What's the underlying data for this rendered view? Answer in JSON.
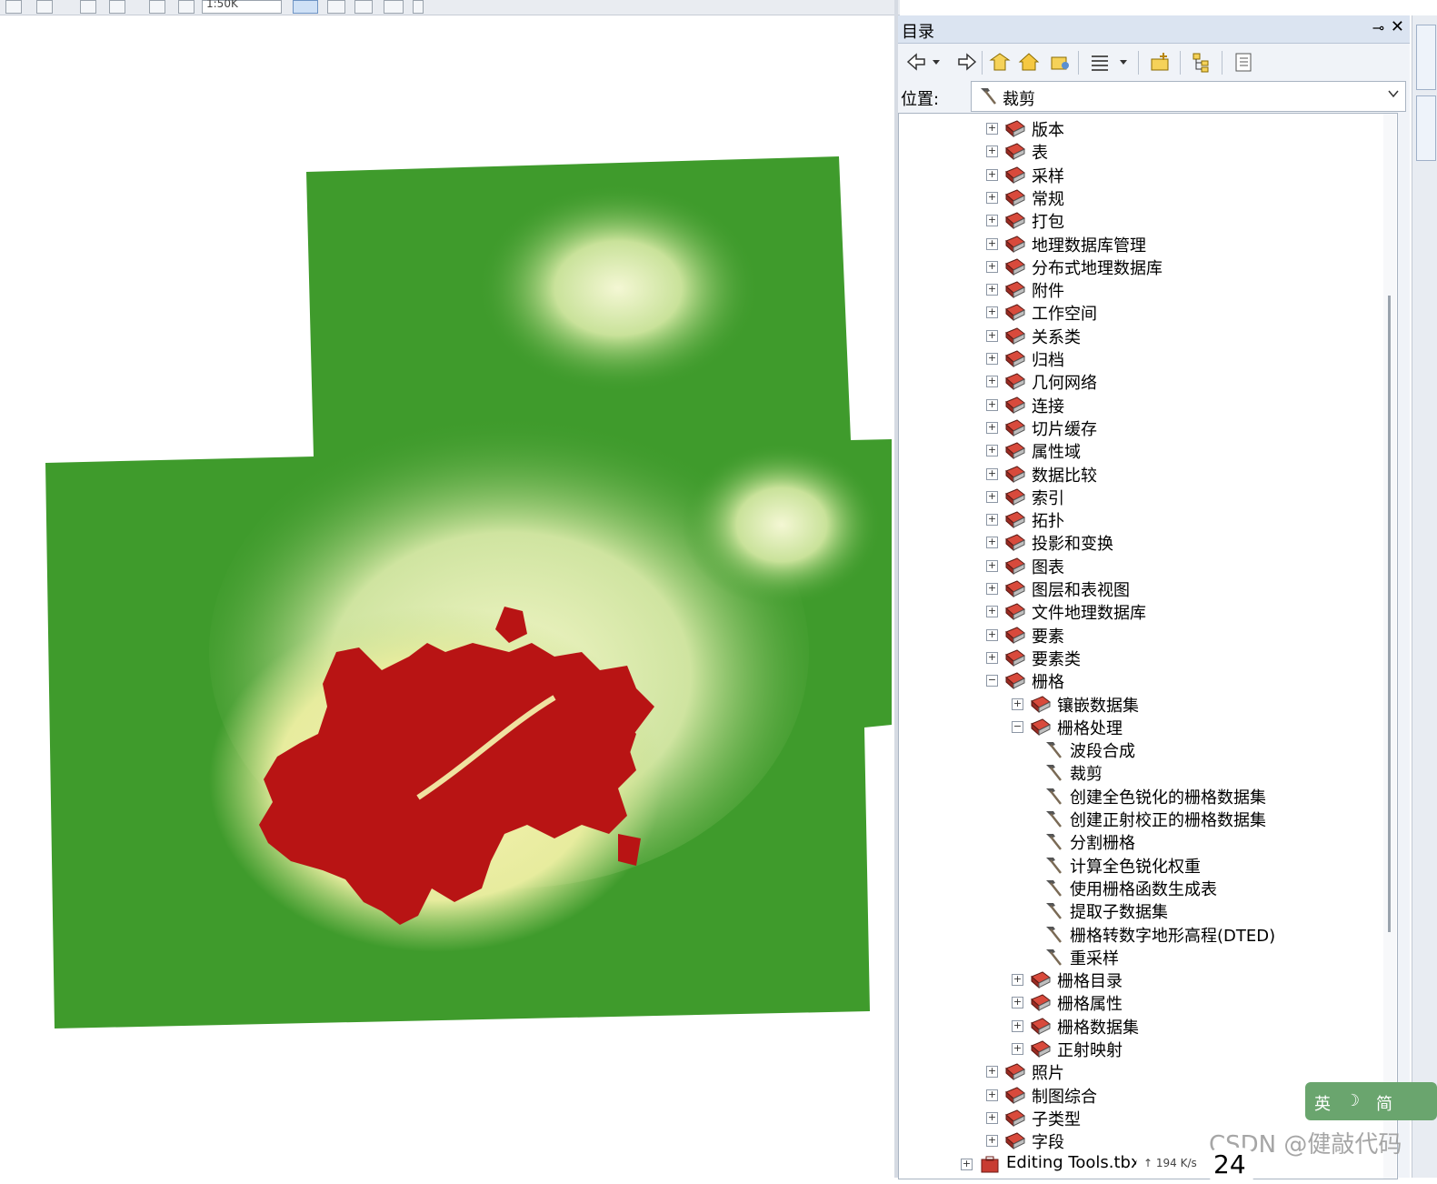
{
  "top_toolbar": {
    "zoom_value": "1:50K"
  },
  "catalog": {
    "title": "目录",
    "pin_glyph": "⊸",
    "close_glyph": "✕",
    "location_label": "位置:",
    "location_value": "裁剪",
    "toolbar_icons": [
      "back-icon",
      "dropdown-icon",
      "forward-icon",
      "up-folder-icon",
      "home-icon",
      "connect-folder-icon",
      "grid-view-icon",
      "dropdown-icon",
      "new-toolbox-icon",
      "tree-view-icon",
      "options-icon"
    ],
    "tree": [
      {
        "label": "版本",
        "level": 0,
        "type": "toolset",
        "state": "collapsed"
      },
      {
        "label": "表",
        "level": 0,
        "type": "toolset",
        "state": "collapsed"
      },
      {
        "label": "采样",
        "level": 0,
        "type": "toolset",
        "state": "collapsed"
      },
      {
        "label": "常规",
        "level": 0,
        "type": "toolset",
        "state": "collapsed"
      },
      {
        "label": "打包",
        "level": 0,
        "type": "toolset",
        "state": "collapsed"
      },
      {
        "label": "地理数据库管理",
        "level": 0,
        "type": "toolset",
        "state": "collapsed"
      },
      {
        "label": "分布式地理数据库",
        "level": 0,
        "type": "toolset",
        "state": "collapsed"
      },
      {
        "label": "附件",
        "level": 0,
        "type": "toolset",
        "state": "collapsed"
      },
      {
        "label": "工作空间",
        "level": 0,
        "type": "toolset",
        "state": "collapsed"
      },
      {
        "label": "关系类",
        "level": 0,
        "type": "toolset",
        "state": "collapsed"
      },
      {
        "label": "归档",
        "level": 0,
        "type": "toolset",
        "state": "collapsed"
      },
      {
        "label": "几何网络",
        "level": 0,
        "type": "toolset",
        "state": "collapsed"
      },
      {
        "label": "连接",
        "level": 0,
        "type": "toolset",
        "state": "collapsed"
      },
      {
        "label": "切片缓存",
        "level": 0,
        "type": "toolset",
        "state": "collapsed"
      },
      {
        "label": "属性域",
        "level": 0,
        "type": "toolset",
        "state": "collapsed"
      },
      {
        "label": "数据比较",
        "level": 0,
        "type": "toolset",
        "state": "collapsed"
      },
      {
        "label": "索引",
        "level": 0,
        "type": "toolset",
        "state": "collapsed"
      },
      {
        "label": "拓扑",
        "level": 0,
        "type": "toolset",
        "state": "collapsed"
      },
      {
        "label": "投影和变换",
        "level": 0,
        "type": "toolset",
        "state": "collapsed"
      },
      {
        "label": "图表",
        "level": 0,
        "type": "toolset",
        "state": "collapsed"
      },
      {
        "label": "图层和表视图",
        "level": 0,
        "type": "toolset",
        "state": "collapsed"
      },
      {
        "label": "文件地理数据库",
        "level": 0,
        "type": "toolset",
        "state": "collapsed"
      },
      {
        "label": "要素",
        "level": 0,
        "type": "toolset",
        "state": "collapsed"
      },
      {
        "label": "要素类",
        "level": 0,
        "type": "toolset",
        "state": "collapsed"
      },
      {
        "label": "栅格",
        "level": 0,
        "type": "toolset",
        "state": "expanded"
      },
      {
        "label": "镶嵌数据集",
        "level": 1,
        "type": "toolset",
        "state": "collapsed"
      },
      {
        "label": "栅格处理",
        "level": 1,
        "type": "toolset",
        "state": "expanded"
      },
      {
        "label": "波段合成",
        "level": 2,
        "type": "tool",
        "state": "none"
      },
      {
        "label": "裁剪",
        "level": 2,
        "type": "tool",
        "state": "none"
      },
      {
        "label": "创建全色锐化的栅格数据集",
        "level": 2,
        "type": "tool",
        "state": "none"
      },
      {
        "label": "创建正射校正的栅格数据集",
        "level": 2,
        "type": "tool",
        "state": "none"
      },
      {
        "label": "分割栅格",
        "level": 2,
        "type": "tool",
        "state": "none"
      },
      {
        "label": "计算全色锐化权重",
        "level": 2,
        "type": "tool",
        "state": "none"
      },
      {
        "label": "使用栅格函数生成表",
        "level": 2,
        "type": "tool",
        "state": "none"
      },
      {
        "label": "提取子数据集",
        "level": 2,
        "type": "tool",
        "state": "none"
      },
      {
        "label": "栅格转数字地形高程(DTED)",
        "level": 2,
        "type": "tool",
        "state": "none"
      },
      {
        "label": "重采样",
        "level": 2,
        "type": "tool",
        "state": "none"
      },
      {
        "label": "栅格目录",
        "level": 1,
        "type": "toolset",
        "state": "collapsed"
      },
      {
        "label": "栅格属性",
        "level": 1,
        "type": "toolset",
        "state": "collapsed"
      },
      {
        "label": "栅格数据集",
        "level": 1,
        "type": "toolset",
        "state": "collapsed"
      },
      {
        "label": "正射映射",
        "level": 1,
        "type": "toolset",
        "state": "collapsed"
      },
      {
        "label": "照片",
        "level": 0,
        "type": "toolset",
        "state": "collapsed"
      },
      {
        "label": "制图综合",
        "level": 0,
        "type": "toolset",
        "state": "collapsed"
      },
      {
        "label": "子类型",
        "level": 0,
        "type": "toolset",
        "state": "collapsed"
      },
      {
        "label": "字段",
        "level": 0,
        "type": "toolset",
        "state": "collapsed"
      },
      {
        "label": "Editing Tools.tbx",
        "level": -1,
        "type": "toolbox",
        "state": "collapsed"
      }
    ]
  },
  "ime": {
    "left": "英",
    "moon": "☽",
    "right": "简"
  },
  "overlay": {
    "watermark": "CSDN @健敲代码",
    "net_speed": "↑ 194 K/s",
    "bubble_number": "24"
  },
  "colors": {
    "dem_low": "#3f9b2c",
    "dem_mid": "#e8f0b0",
    "dem_high": "#b81414",
    "arrow": "#e0201c",
    "panel_bg": "#f0f3f8",
    "title_bg": "#dbe4f1"
  }
}
